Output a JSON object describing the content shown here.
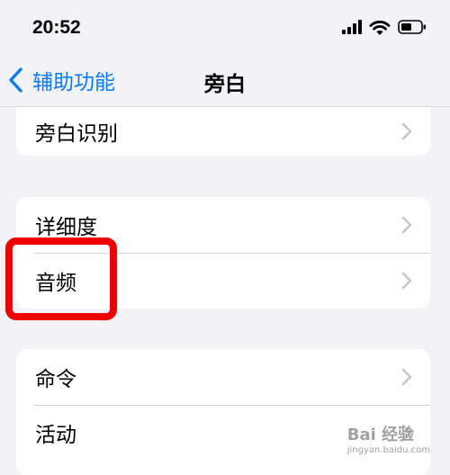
{
  "status_bar": {
    "time": "20:52",
    "icons": [
      "cellular-signal-icon",
      "wifi-icon",
      "battery-icon"
    ]
  },
  "nav": {
    "back_label": "辅助功能",
    "title": "旁白"
  },
  "groups": [
    {
      "rows": [
        {
          "label": "旁白识别"
        }
      ]
    },
    {
      "rows": [
        {
          "label": "详细度"
        },
        {
          "label": "音频"
        }
      ]
    },
    {
      "rows": [
        {
          "label": "命令"
        },
        {
          "label": "活动"
        }
      ]
    }
  ],
  "watermark": {
    "brand": "Bai 经验",
    "url": "jingyan.baidu.com"
  },
  "colors": {
    "accent": "#0a7aff",
    "highlight": "#ee0000",
    "background": "#f2f2f7"
  }
}
